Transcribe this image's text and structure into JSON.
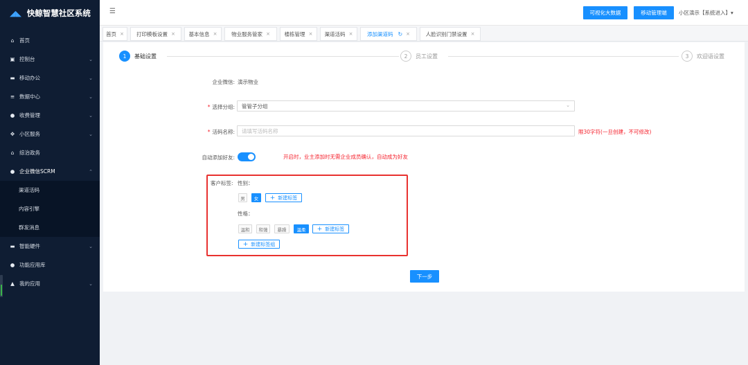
{
  "app": {
    "title": "快鲸智慧社区系统"
  },
  "sidebar": {
    "items": [
      {
        "label": "首页",
        "icon": "home-icon",
        "glyph": "⌂",
        "arrow": ""
      },
      {
        "label": "控制台",
        "icon": "monitor-icon",
        "glyph": "▣",
        "arrow": "⌄"
      },
      {
        "label": "移动办公",
        "icon": "briefcase-icon",
        "glyph": "▬",
        "arrow": "⌄"
      },
      {
        "label": "数据中心",
        "icon": "database-icon",
        "glyph": "≡",
        "arrow": "⌄"
      },
      {
        "label": "收费管理",
        "icon": "money-bag-icon",
        "glyph": "●",
        "arrow": "⌄"
      },
      {
        "label": "小区服务",
        "icon": "service-icon",
        "glyph": "✥",
        "arrow": "⌄"
      },
      {
        "label": "综治政务",
        "icon": "government-icon",
        "glyph": "⌂",
        "arrow": ""
      },
      {
        "label": "企业微信SCRM",
        "icon": "wechat-icon",
        "glyph": "●",
        "arrow": "⌃"
      }
    ],
    "sub_items": [
      {
        "label": "渠道活码"
      },
      {
        "label": "内容引擎"
      },
      {
        "label": "群发消息"
      }
    ],
    "items_after": [
      {
        "label": "智能硬件",
        "icon": "hardware-icon",
        "glyph": "▬",
        "arrow": "⌄"
      },
      {
        "label": "功能应用库",
        "icon": "app-library-icon",
        "glyph": "●",
        "arrow": ""
      },
      {
        "label": "我的应用",
        "icon": "user-icon",
        "glyph": "▲",
        "arrow": "⌄"
      }
    ]
  },
  "header": {
    "bigdata_label": "可视化大数据",
    "mobile_label": "移动管理端",
    "user_label": "小区演示【系统进入】▾"
  },
  "tabs": [
    {
      "label": "首页"
    },
    {
      "label": "打印模板设置"
    },
    {
      "label": "基本信息"
    },
    {
      "label": "物业服务管家"
    },
    {
      "label": "楼栋管理"
    },
    {
      "label": "渠道活码"
    },
    {
      "label": "添加渠道码"
    },
    {
      "label": "人脸识别门禁设置"
    }
  ],
  "steps": [
    {
      "num": "1",
      "label": "基础设置"
    },
    {
      "num": "2",
      "label": "员工设置"
    },
    {
      "num": "3",
      "label": "欢迎语设置"
    }
  ],
  "form": {
    "enterprise_label": "企业微信:",
    "enterprise_value": "演示物业",
    "group_label": "选择分组:",
    "group_value": "管管子分组",
    "name_label": "活码名称:",
    "name_placeholder": "请填写活码名称",
    "name_hint": "限30字符(一旦创建，不可修改)",
    "auto_friend_label": "自动添加好友:",
    "auto_friend_on": true,
    "auto_friend_hint": "开启时，业主添加时无需企业成员确认，自动成为好友",
    "customer_tag_label": "客户标签:",
    "gender_label": "性别：",
    "gender_tags": [
      {
        "label": "男",
        "selected": false
      },
      {
        "label": "女",
        "selected": true
      }
    ],
    "new_tag_label": "新建标签",
    "personality_label": "性格：",
    "personality_tags": [
      {
        "label": "温和",
        "selected": false
      },
      {
        "label": "和蔼",
        "selected": false
      },
      {
        "label": "暴躁",
        "selected": false
      },
      {
        "label": "温柔",
        "selected": true
      }
    ],
    "new_tag_group_label": "新建标签组",
    "next_label": "下一步"
  },
  "colors": {
    "primary": "#1890ff",
    "sidebar_bg": "#0f1d33",
    "danger": "#f5222d"
  }
}
